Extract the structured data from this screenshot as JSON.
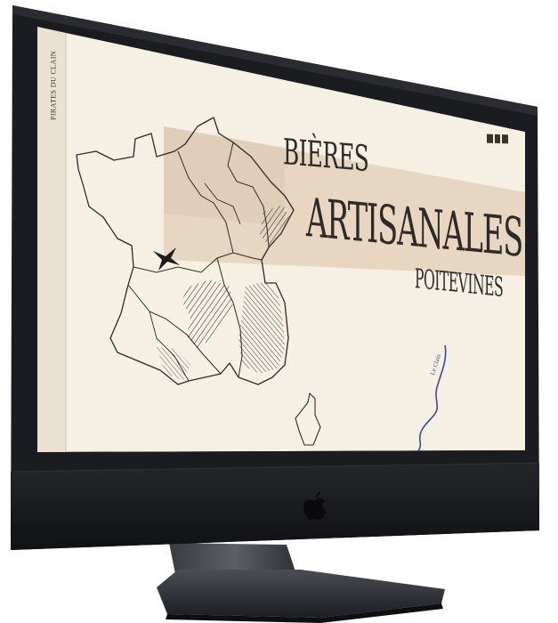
{
  "website": {
    "side_tag": "PIRATES DU CLAIN",
    "headline": {
      "line1": "BIÈRES",
      "line2": "ARTISANALES",
      "line3": "POITEVINES"
    },
    "river_label": "Le Clain",
    "menu_icon": "hamburger-menu-icon"
  },
  "device": {
    "type": "imac",
    "logo_icon": "apple-logo-icon"
  },
  "colors": {
    "screen_bg": "#f5efe4",
    "beige_band": "#e6d6c2",
    "ink": "#2d2a28",
    "river": "#3949a0",
    "bezel": "#1b1c20"
  }
}
